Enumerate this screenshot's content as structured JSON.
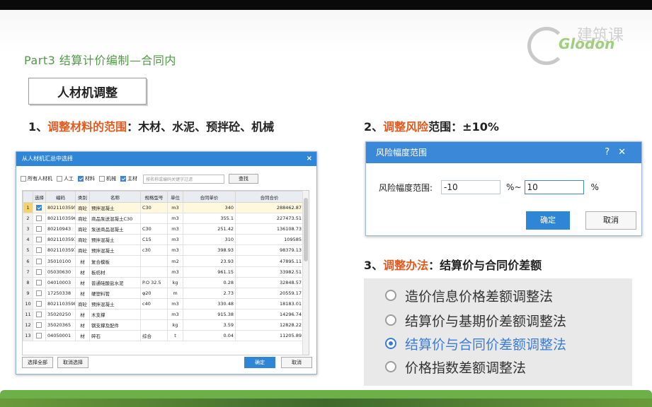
{
  "slide": {
    "title": "Part3 结算计价编制—合同内",
    "section": "人材机调整",
    "logo_text": "Glodon",
    "logo_text_cn": "建筑课"
  },
  "points": [
    {
      "num": "1、",
      "highlight": "调整材料的范围",
      "rest": "：木材、水泥、预拌砼、机械"
    },
    {
      "num": "2、",
      "highlight": "调整风险",
      "rest": "范围：±10%"
    },
    {
      "num": "3、",
      "highlight": "调整办法",
      "rest": "：结算价与合同价差额"
    }
  ],
  "select_dialog": {
    "title": "从人材机汇总中选择",
    "filters": [
      {
        "label": "所有人材机",
        "checked": false
      },
      {
        "label": "人工",
        "checked": false
      },
      {
        "label": "材料",
        "checked": true
      },
      {
        "label": "机械",
        "checked": false
      },
      {
        "label": "主材",
        "checked": true
      }
    ],
    "search_placeholder": "按名称或编码关键字过滤",
    "find_label": "查找",
    "columns": [
      "选择",
      "编码",
      "类别",
      "名称",
      "规格型号",
      "单位",
      "合同单价",
      "合同合价"
    ],
    "rows": [
      {
        "no": "1",
        "checked": true,
        "code": "8021103595",
        "cat": "商砼",
        "name": "预拌混凝土",
        "spec": "C30",
        "unit": "m3",
        "price": "340",
        "total": "288462.87"
      },
      {
        "no": "2",
        "checked": false,
        "code": "8021103596",
        "cat": "商砼",
        "name": "商品泵送混凝土C30",
        "spec": "",
        "unit": "m3",
        "price": "355.1",
        "total": "227473.51"
      },
      {
        "no": "3",
        "checked": false,
        "code": "80210943",
        "cat": "商砼",
        "name": "泵送商品混凝土",
        "spec": "C30",
        "unit": "m3",
        "price": "251.42",
        "total": "136108.73"
      },
      {
        "no": "4",
        "checked": false,
        "code": "8021103591",
        "cat": "商砼",
        "name": "预拌混凝土",
        "spec": "C15",
        "unit": "m3",
        "price": "310",
        "total": "109585"
      },
      {
        "no": "5",
        "checked": false,
        "code": "8021103597",
        "cat": "商砼",
        "name": "预拌混凝土",
        "spec": "c30",
        "unit": "m3",
        "price": "398.93",
        "total": "98379.13"
      },
      {
        "no": "6",
        "checked": false,
        "code": "35010100",
        "cat": "材",
        "name": "复合模板",
        "spec": "",
        "unit": "m2",
        "price": "23.93",
        "total": "47895.11"
      },
      {
        "no": "7",
        "checked": false,
        "code": "05030630",
        "cat": "材",
        "name": "板枋材",
        "spec": "",
        "unit": "m3",
        "price": "961.15",
        "total": "33982.51"
      },
      {
        "no": "8",
        "checked": false,
        "code": "04010003",
        "cat": "材",
        "name": "普通硅酸盐水泥",
        "spec": "P.O 32.5",
        "unit": "kg",
        "price": "0.28",
        "total": "32848.57"
      },
      {
        "no": "9",
        "checked": false,
        "code": "17250338",
        "cat": "材",
        "name": "硬塑料管",
        "spec": "φ20",
        "unit": "m",
        "price": "2.73",
        "total": "20559.17"
      },
      {
        "no": "10",
        "checked": false,
        "code": "8021103598",
        "cat": "商砼",
        "name": "预拌混凝土",
        "spec": "c40",
        "unit": "m3",
        "price": "330.48",
        "total": "18183.01"
      },
      {
        "no": "11",
        "checked": false,
        "code": "35020250",
        "cat": "材",
        "name": "木支撑",
        "spec": "",
        "unit": "m3",
        "price": "915.38",
        "total": "14296.74"
      },
      {
        "no": "12",
        "checked": false,
        "code": "35020365",
        "cat": "材",
        "name": "钢支撑及配件",
        "spec": "",
        "unit": "kg",
        "price": "3.59",
        "total": "12828.22"
      },
      {
        "no": "13",
        "checked": false,
        "code": "04050001",
        "cat": "材",
        "name": "碎石",
        "spec": "综合",
        "unit": "t",
        "price": "0.04",
        "total": "11205.89"
      }
    ],
    "select_all": "选择全部",
    "cancel_select": "取消选择",
    "ok": "确定",
    "cancel": "取消"
  },
  "risk_dialog": {
    "title": "风险幅度范围",
    "label": "风险幅度范围:",
    "min": "-10",
    "sep": "%~",
    "max": "10",
    "unit": "%",
    "ok": "确定",
    "cancel": "取消",
    "help_icon": "?",
    "close_icon": "✕"
  },
  "methods": [
    {
      "label": "造价信息价格差额调整法",
      "selected": false
    },
    {
      "label": "结算价与基期价差额调整法",
      "selected": false
    },
    {
      "label": "结算价与合同价差额调整法",
      "selected": true
    },
    {
      "label": "价格指数差额调整法",
      "selected": false
    }
  ]
}
